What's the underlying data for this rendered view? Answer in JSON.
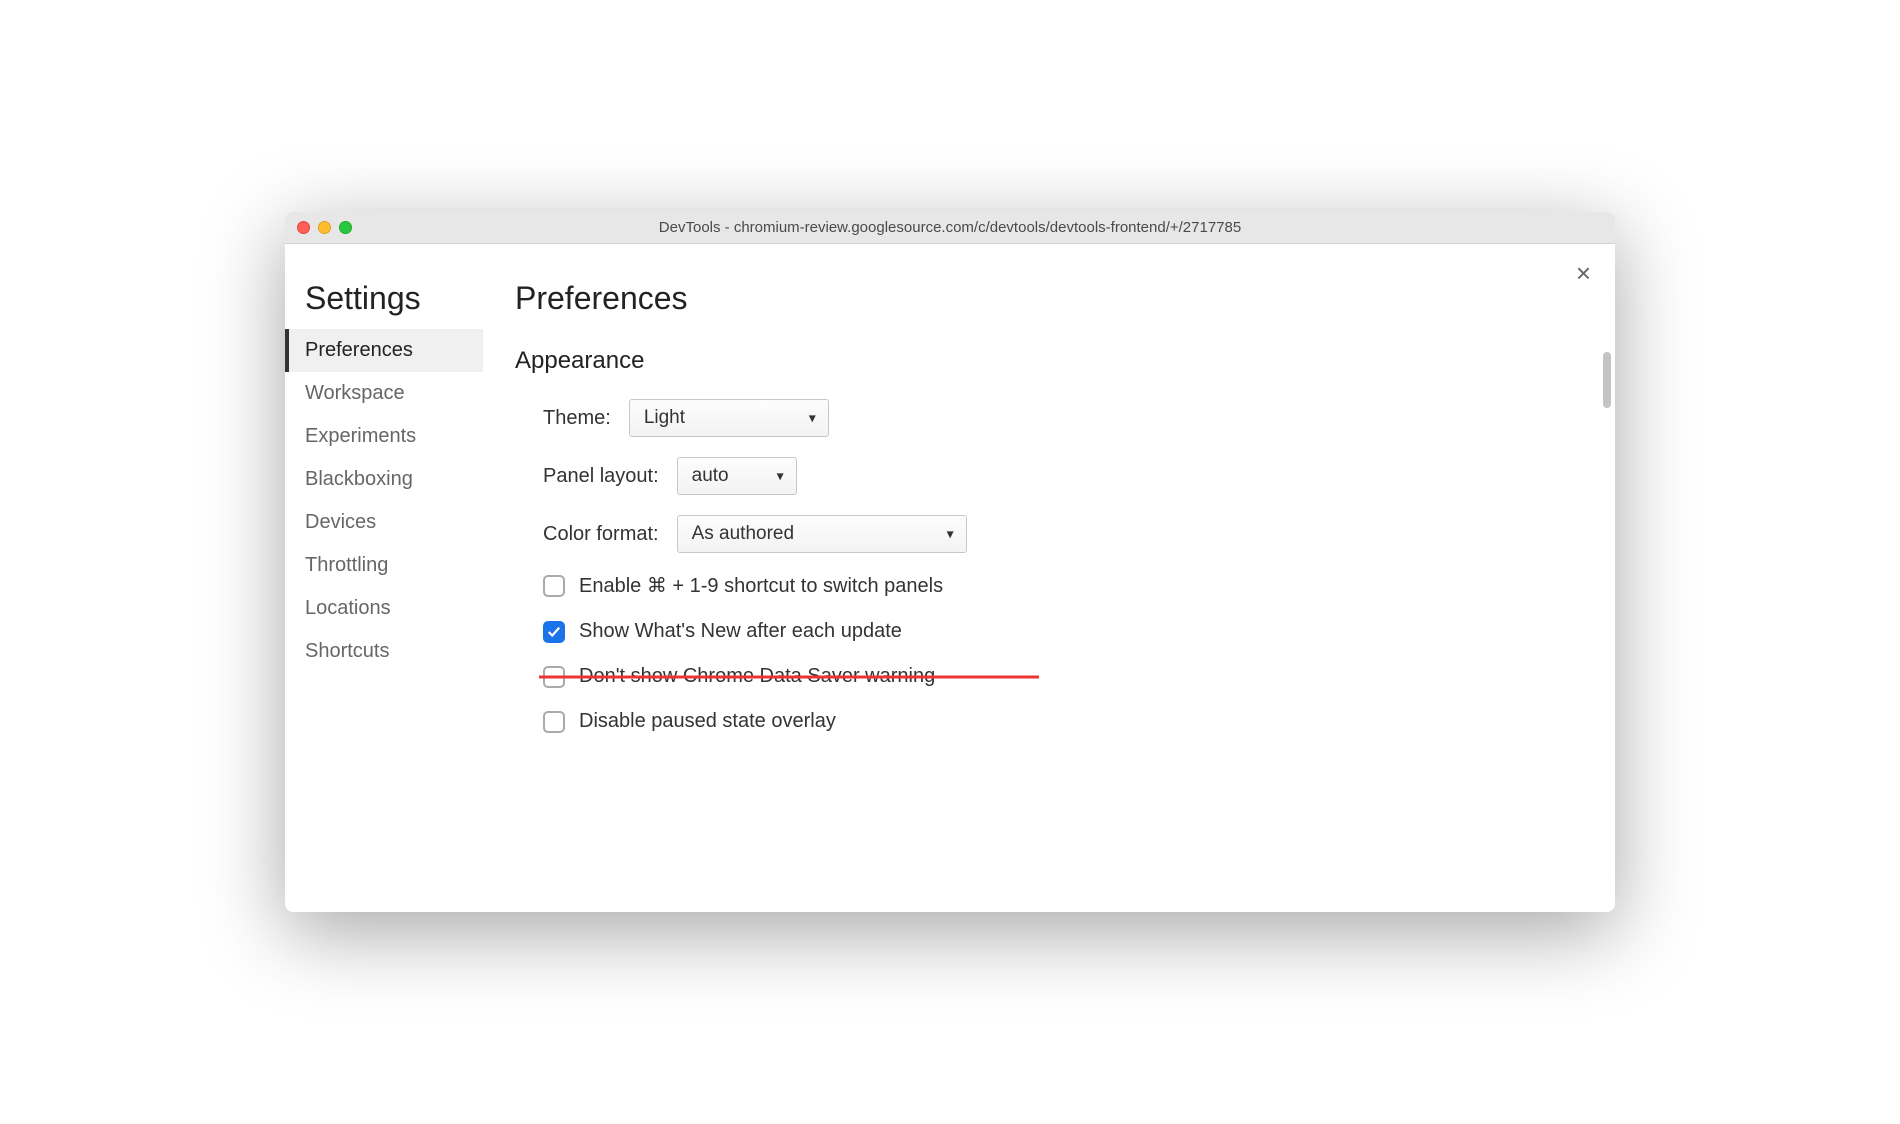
{
  "titlebar": {
    "title": "DevTools - chromium-review.googlesource.com/c/devtools/devtools-frontend/+/2717785"
  },
  "sidebar": {
    "title": "Settings",
    "items": [
      {
        "label": "Preferences",
        "active": true
      },
      {
        "label": "Workspace",
        "active": false
      },
      {
        "label": "Experiments",
        "active": false
      },
      {
        "label": "Blackboxing",
        "active": false
      },
      {
        "label": "Devices",
        "active": false
      },
      {
        "label": "Throttling",
        "active": false
      },
      {
        "label": "Locations",
        "active": false
      },
      {
        "label": "Shortcuts",
        "active": false
      }
    ]
  },
  "main": {
    "title": "Preferences",
    "section": "Appearance",
    "theme_label": "Theme:",
    "theme_value": "Light",
    "panel_layout_label": "Panel layout:",
    "panel_layout_value": "auto",
    "color_format_label": "Color format:",
    "color_format_value": "As authored",
    "checkboxes": [
      {
        "label": "Enable ⌘ + 1-9 shortcut to switch panels",
        "checked": false,
        "struck": false
      },
      {
        "label": "Show What's New after each update",
        "checked": true,
        "struck": false
      },
      {
        "label": "Don't show Chrome Data Saver warning",
        "checked": false,
        "struck": true
      },
      {
        "label": "Disable paused state overlay",
        "checked": false,
        "struck": false
      }
    ]
  }
}
